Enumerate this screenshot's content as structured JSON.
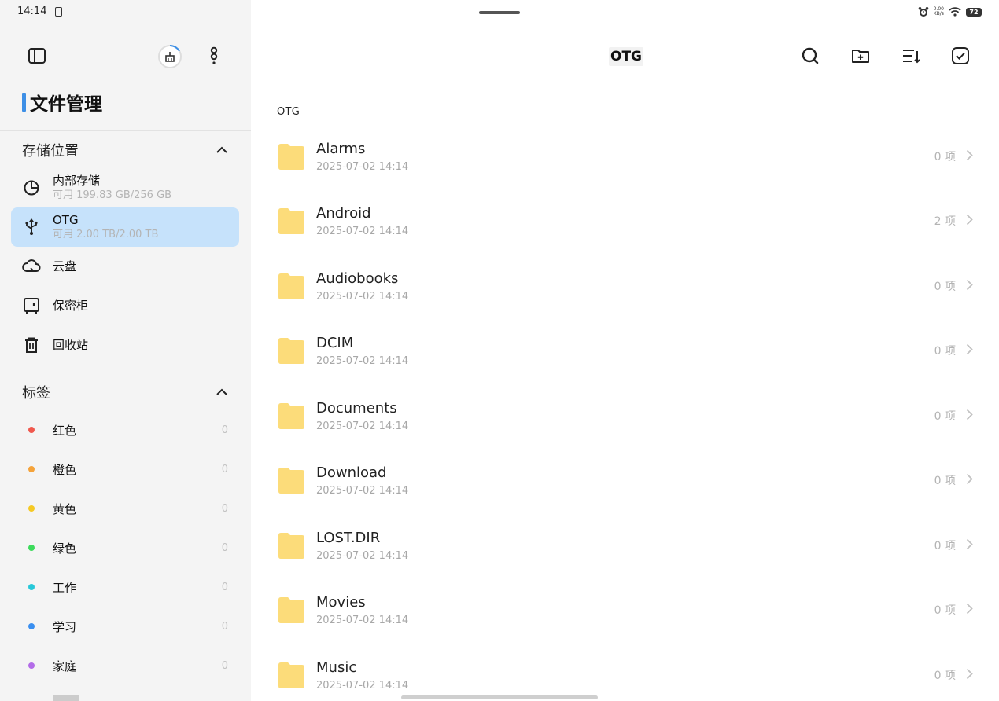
{
  "status_bar": {
    "time": "14:14",
    "net_speed": "0.00\nKB/s",
    "battery": "72"
  },
  "app": {
    "title": "文件管理"
  },
  "storage_section": {
    "title": "存储位置",
    "items": [
      {
        "label": "内部存储",
        "sub": "可用 199.83 GB/256 GB",
        "icon": "pie-chart-icon"
      },
      {
        "label": "OTG",
        "sub": "可用 2.00 TB/2.00 TB",
        "icon": "usb-icon"
      },
      {
        "label": "云盘",
        "icon": "cloud-icon"
      },
      {
        "label": "保密柜",
        "icon": "safe-icon"
      },
      {
        "label": "回收站",
        "icon": "trash-icon"
      }
    ]
  },
  "tags_section": {
    "title": "标签",
    "items": [
      {
        "label": "红色",
        "count": "0",
        "color": "#f0584d"
      },
      {
        "label": "橙色",
        "count": "0",
        "color": "#f5a33a"
      },
      {
        "label": "黄色",
        "count": "0",
        "color": "#f5c924"
      },
      {
        "label": "绿色",
        "count": "0",
        "color": "#3ddb5c"
      },
      {
        "label": "工作",
        "count": "0",
        "color": "#27c8d9"
      },
      {
        "label": "学习",
        "count": "0",
        "color": "#3a8ff0"
      },
      {
        "label": "家庭",
        "count": "0",
        "color": "#b36ce8"
      }
    ]
  },
  "header": {
    "title": "OTG"
  },
  "breadcrumb": "OTG",
  "files": [
    {
      "name": "Alarms",
      "date": "2025-07-02 14:14",
      "count": "0 项"
    },
    {
      "name": "Android",
      "date": "2025-07-02 14:14",
      "count": "2 项"
    },
    {
      "name": "Audiobooks",
      "date": "2025-07-02 14:14",
      "count": "0 项"
    },
    {
      "name": "DCIM",
      "date": "2025-07-02 14:14",
      "count": "0 项"
    },
    {
      "name": "Documents",
      "date": "2025-07-02 14:14",
      "count": "0 项"
    },
    {
      "name": "Download",
      "date": "2025-07-02 14:14",
      "count": "0 项"
    },
    {
      "name": "LOST.DIR",
      "date": "2025-07-02 14:14",
      "count": "0 项"
    },
    {
      "name": "Movies",
      "date": "2025-07-02 14:14",
      "count": "0 项"
    },
    {
      "name": "Music",
      "date": "2025-07-02 14:14",
      "count": "0 项"
    }
  ],
  "colors": {
    "accent": "#3d8fe6",
    "active_bg": "#c6e2fb",
    "folder": "#fcdc7a"
  }
}
